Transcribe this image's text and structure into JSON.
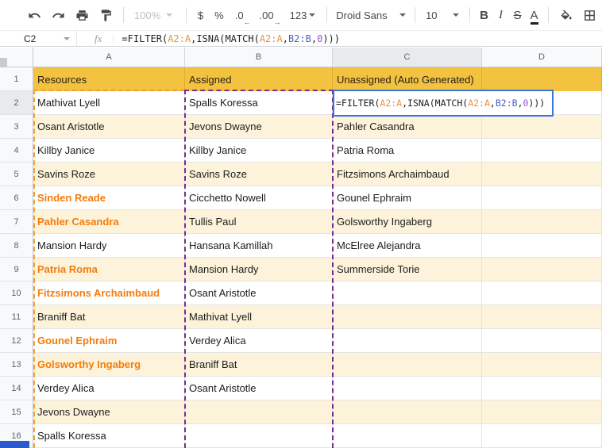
{
  "toolbar": {
    "zoom_value": "100%",
    "currency_label": "$",
    "percent_label": "%",
    "decrease_decimals_label": ".0",
    "decrease_decimals_arrow": "←",
    "increase_decimals_label": ".00",
    "increase_decimals_arrow": "→",
    "number_format_label": "123",
    "font_family_value": "Droid Sans",
    "font_size_value": "10",
    "bold_label": "B",
    "italic_label": "I",
    "strikethrough_label": "S",
    "text_color_label": "A",
    "icons": [
      "undo-icon",
      "redo-icon",
      "print-icon",
      "paint-format-icon",
      "fill-color-icon",
      "borders-icon"
    ]
  },
  "formula_bar": {
    "cell_reference": "C2",
    "fx_label": "fx"
  },
  "formula_parts": [
    {
      "text": "=FILTER(",
      "color": "#202124"
    },
    {
      "text": "A2:A",
      "color": "#e8913d"
    },
    {
      "text": ",",
      "color": "#202124"
    },
    {
      "text": "ISNA(MATCH(",
      "color": "#202124"
    },
    {
      "text": "A2:A",
      "color": "#e8913d"
    },
    {
      "text": ",",
      "color": "#202124"
    },
    {
      "text": "B2:B",
      "color": "#4a5fc8"
    },
    {
      "text": ",",
      "color": "#202124"
    },
    {
      "text": "0",
      "color": "#a64ed2"
    },
    {
      "text": ")))",
      "color": "#202124"
    }
  ],
  "colors": {
    "header_band": "#f3c23e",
    "banding_stripe": "#fdf3db",
    "orange_text": "#f57c0c",
    "range_a_border": "#efa03f",
    "range_b_border": "#7b2c8f",
    "edit_border": "#3777e3"
  },
  "grid": {
    "column_headers": [
      "A",
      "B",
      "C",
      "D"
    ],
    "selected_column_header": "C",
    "selected_row_header": 2,
    "header_row": [
      "Resources",
      "Assigned",
      "Unassigned (Auto Generated)",
      ""
    ],
    "rows": [
      {
        "n": 2,
        "a": "Mathivat Lyell",
        "a_orange": false,
        "b": "Spalls Koressa",
        "c": ""
      },
      {
        "n": 3,
        "a": "Osant Aristotle",
        "a_orange": false,
        "b": "Jevons Dwayne",
        "c": "Pahler Casandra"
      },
      {
        "n": 4,
        "a": "Killby Janice",
        "a_orange": false,
        "b": "Killby Janice",
        "c": "Patria Roma"
      },
      {
        "n": 5,
        "a": "Savins Roze",
        "a_orange": false,
        "b": "Savins Roze",
        "c": "Fitzsimons Archaimbaud"
      },
      {
        "n": 6,
        "a": "Sinden Reade",
        "a_orange": true,
        "b": "Cicchetto Nowell",
        "c": "Gounel Ephraim"
      },
      {
        "n": 7,
        "a": "Pahler Casandra",
        "a_orange": true,
        "b": "Tullis Paul",
        "c": "Golsworthy Ingaberg"
      },
      {
        "n": 8,
        "a": "Mansion Hardy",
        "a_orange": false,
        "b": "Hansana Kamillah",
        "c": "McElree Alejandra"
      },
      {
        "n": 9,
        "a": "Patria Roma",
        "a_orange": true,
        "b": "Mansion Hardy",
        "c": "Summerside Torie"
      },
      {
        "n": 10,
        "a": "Fitzsimons Archaimbaud",
        "a_orange": true,
        "b": "Osant Aristotle",
        "c": ""
      },
      {
        "n": 11,
        "a": "Braniff Bat",
        "a_orange": false,
        "b": "Mathivat Lyell",
        "c": ""
      },
      {
        "n": 12,
        "a": "Gounel Ephraim",
        "a_orange": true,
        "b": "Verdey Alica",
        "c": ""
      },
      {
        "n": 13,
        "a": "Golsworthy Ingaberg",
        "a_orange": true,
        "b": "Braniff Bat",
        "c": ""
      },
      {
        "n": 14,
        "a": "Verdey Alica",
        "a_orange": false,
        "b": "Osant Aristotle",
        "c": ""
      },
      {
        "n": 15,
        "a": "Jevons Dwayne",
        "a_orange": false,
        "b": "",
        "c": ""
      },
      {
        "n": 16,
        "a": "Spalls Koressa",
        "a_orange": false,
        "b": "",
        "c": ""
      }
    ]
  }
}
